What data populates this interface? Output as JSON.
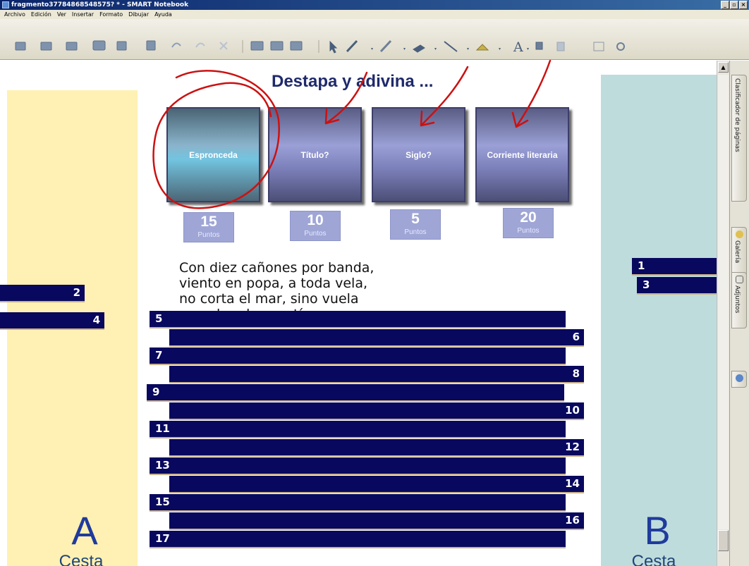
{
  "window": {
    "title": "fragmento37784868548575? * - SMART Notebook",
    "buttons": [
      "_",
      "▫",
      "×"
    ]
  },
  "menubar": {
    "items": [
      "Archivo",
      "Edición",
      "Ver",
      "Insertar",
      "Formato",
      "Dibujar",
      "Ayuda"
    ]
  },
  "toolbar": {
    "file_icons": [
      "new-page-icon",
      "previous-page-icon",
      "next-page-icon",
      "open-icon",
      "save-icon",
      "paste-icon",
      "undo-icon",
      "redo-icon",
      "delete-icon",
      "screen-shade-icon",
      "full-screen-icon",
      "capture-icon"
    ],
    "tool_icons": [
      "select-arrow-icon",
      "pen-icon",
      "creative-pen-icon",
      "eraser-icon",
      "line-icon",
      "shapes-icon",
      "text-icon",
      "fill-icon",
      "properties-icon",
      "table-icon",
      "magic-pen-icon"
    ],
    "text_tool_glyph": "A"
  },
  "page": {
    "title": "Destapa y adivina ...",
    "cards": [
      {
        "label": "Espronceda",
        "style": "teal"
      },
      {
        "label": "Título?",
        "style": "violet"
      },
      {
        "label": "Siglo?",
        "style": "violet"
      },
      {
        "label": "Corriente literaria",
        "style": "violet"
      }
    ],
    "points": [
      {
        "value": "15",
        "label": "Puntos"
      },
      {
        "value": "10",
        "label": "Puntos"
      },
      {
        "value": "5",
        "label": "Puntos"
      },
      {
        "value": "20",
        "label": "Puntos"
      }
    ],
    "poem": [
      "Con diez cañones por banda,",
      "viento en popa, a toda vela,",
      "no corta el mar, sino vuela",
      "un velero bergantín."
    ],
    "basket_a": {
      "letter": "A",
      "word": "Cesta"
    },
    "basket_b": {
      "letter": "B",
      "word": "Cesta"
    },
    "side_strips_left": [
      {
        "number": "2"
      },
      {
        "number": "4"
      }
    ],
    "side_strips_right": [
      {
        "number": "1"
      },
      {
        "number": "3"
      }
    ],
    "strips": [
      {
        "number": "5",
        "align": "left"
      },
      {
        "number": "6",
        "align": "right"
      },
      {
        "number": "7",
        "align": "left"
      },
      {
        "number": "8",
        "align": "right"
      },
      {
        "number": "9",
        "align": "left"
      },
      {
        "number": "10",
        "align": "right"
      },
      {
        "number": "11",
        "align": "left"
      },
      {
        "number": "12",
        "align": "right"
      },
      {
        "number": "13",
        "align": "left"
      },
      {
        "number": "14",
        "align": "right"
      },
      {
        "number": "15",
        "align": "left"
      },
      {
        "number": "16",
        "align": "right"
      },
      {
        "number": "17",
        "align": "left"
      }
    ]
  },
  "side_tabs": [
    {
      "label": "Clasificador de páginas",
      "icon": "page-sorter-icon"
    },
    {
      "label": "Galería",
      "icon": "gallery-icon"
    },
    {
      "label": "Adjuntos",
      "icon": "attachments-icon"
    },
    {
      "label": "",
      "icon": "properties-tab-icon"
    }
  ],
  "colors": {
    "strip": "#08085e",
    "panel_a": "#fff1b3",
    "panel_b": "#bedcdc",
    "ink": "#cc1111",
    "title": "#1f2a6b"
  }
}
